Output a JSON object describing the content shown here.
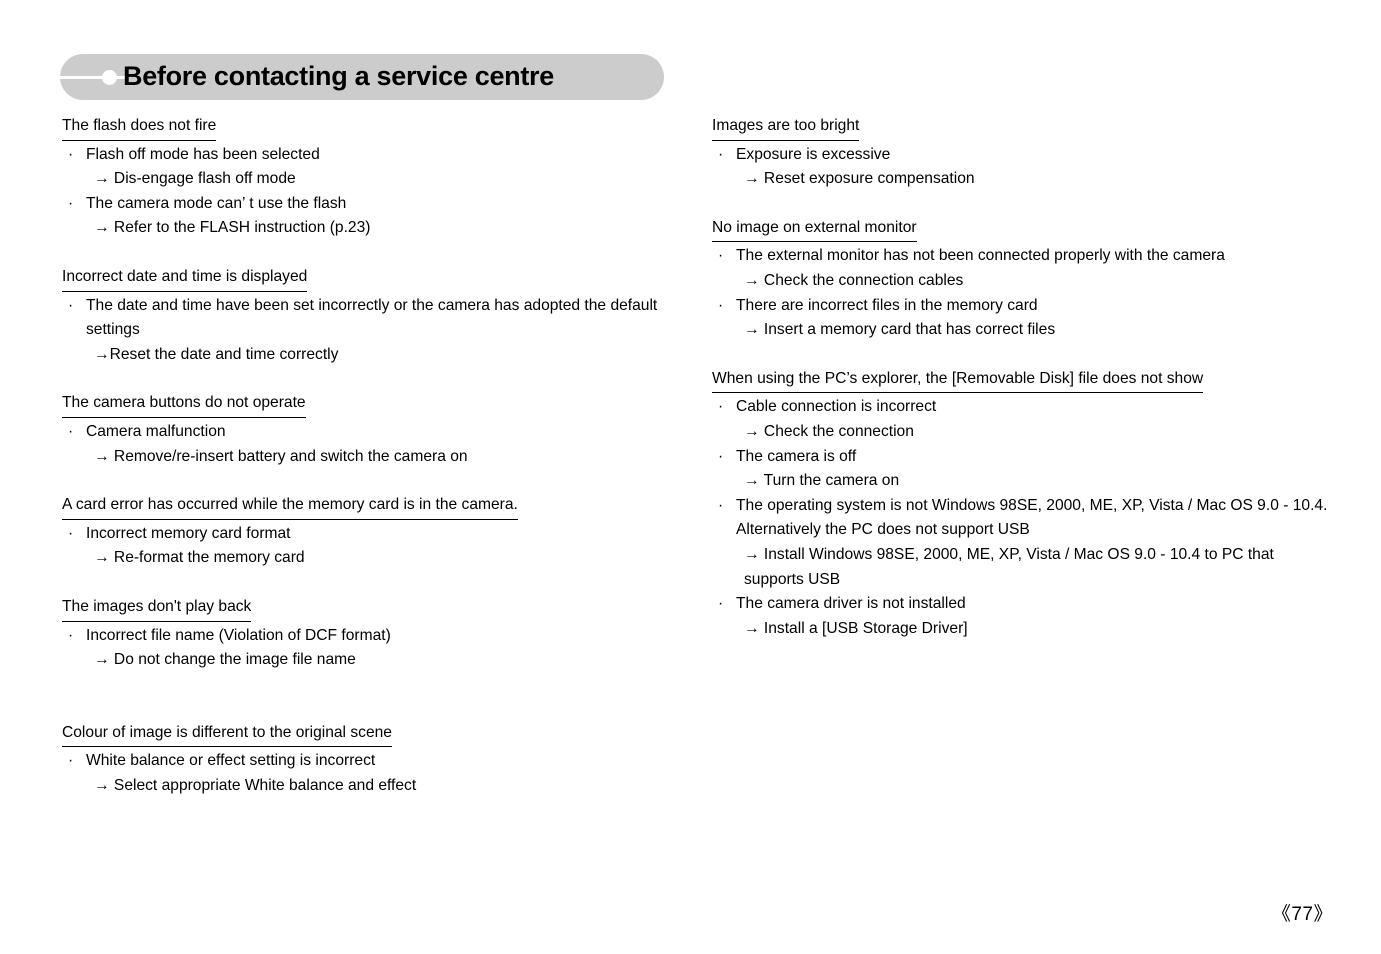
{
  "header": {
    "title": "Before contacting a service centre",
    "pill_color": "#cccccc",
    "marker_color": "#ffffff"
  },
  "left_column": [
    {
      "heading": "The flash does not fire",
      "lines": [
        {
          "type": "bullet",
          "text": "Flash off mode has been selected"
        },
        {
          "type": "arrow",
          "text": "→ Dis-engage flash off mode"
        },
        {
          "type": "bullet",
          "text": "The camera mode can’ t use the flash"
        },
        {
          "type": "arrow",
          "text": "→ Refer to the FLASH instruction (p.23)"
        }
      ]
    },
    {
      "heading": "Incorrect date and time is displayed",
      "lines": [
        {
          "type": "bullet",
          "text": "The date and time have been set incorrectly or the camera has adopted the default settings"
        },
        {
          "type": "arrow",
          "text": "→Reset the date and time correctly"
        }
      ]
    },
    {
      "heading": "The camera buttons do not operate",
      "lines": [
        {
          "type": "bullet",
          "text": "Camera malfunction"
        },
        {
          "type": "arrow",
          "text": "→ Remove/re-insert battery and switch the camera on"
        }
      ]
    },
    {
      "heading": "A card error has occurred while the memory card is in the camera.",
      "lines": [
        {
          "type": "bullet",
          "text": "Incorrect memory card format"
        },
        {
          "type": "arrow",
          "text": "→ Re-format the memory card"
        }
      ]
    },
    {
      "heading": "The images don't play back",
      "lines": [
        {
          "type": "bullet",
          "text": "Incorrect file name (Violation of DCF format)"
        },
        {
          "type": "arrow",
          "text": "→ Do not change the image file name"
        }
      ]
    },
    {
      "heading": "Colour of image is different to the original scene",
      "big_gap": true,
      "lines": [
        {
          "type": "bullet",
          "text": "White balance or effect setting is incorrect"
        },
        {
          "type": "arrow",
          "text": "→ Select appropriate White balance and effect"
        }
      ]
    }
  ],
  "right_column": [
    {
      "heading": "Images are too bright",
      "lines": [
        {
          "type": "bullet",
          "text": "Exposure is excessive"
        },
        {
          "type": "arrow",
          "text": "→ Reset exposure compensation"
        }
      ]
    },
    {
      "heading": "No image on external monitor",
      "lines": [
        {
          "type": "bullet",
          "text": "The external monitor has not been connected properly with the camera"
        },
        {
          "type": "arrow",
          "text": "→ Check the connection cables"
        },
        {
          "type": "bullet",
          "text": "There are incorrect files in the memory card"
        },
        {
          "type": "arrow",
          "text": "→ Insert a memory card that has correct files"
        }
      ]
    },
    {
      "heading": "When using the PC’s explorer, the [Removable Disk] file does not show",
      "lines": [
        {
          "type": "bullet",
          "text": "Cable connection is incorrect"
        },
        {
          "type": "arrow",
          "text": "→ Check the connection"
        },
        {
          "type": "bullet",
          "text": "The camera is off"
        },
        {
          "type": "arrow",
          "text": "→ Turn the camera on"
        },
        {
          "type": "bullet",
          "text": "The operating system is not Windows 98SE, 2000, ME, XP, Vista / Mac OS 9.0 - 10.4. Alternatively the PC does not support USB"
        },
        {
          "type": "arrow",
          "text": "→ Install Windows 98SE, 2000, ME, XP, Vista / Mac OS 9.0 - 10.4 to PC that supports USB"
        },
        {
          "type": "bullet",
          "text": "The camera driver is not installed"
        },
        {
          "type": "arrow",
          "text": "→ Install a [USB Storage Driver]"
        }
      ]
    }
  ],
  "footer": {
    "page_number": "《77》"
  },
  "symbols": {
    "bullet": "·"
  }
}
